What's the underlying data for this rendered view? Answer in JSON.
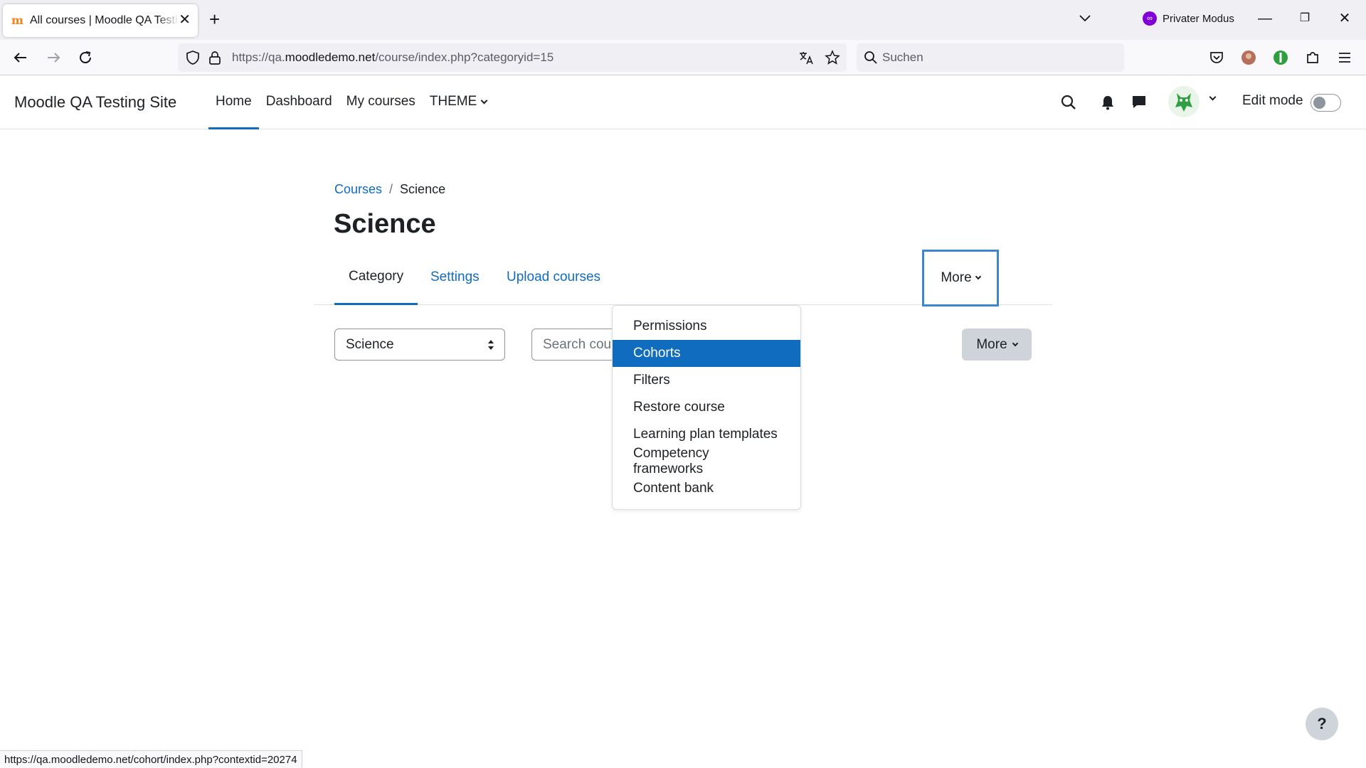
{
  "browser": {
    "tab_title": "All courses | Moodle QA Testing Site",
    "private_mode_label": "Privater Modus",
    "url_prefix": "https://qa.",
    "url_host": "moodledemo.net",
    "url_path": "/course/index.php?categoryid=15",
    "search_placeholder": "Suchen",
    "status_url": "https://qa.moodledemo.net/cohort/index.php?contextid=20274"
  },
  "header": {
    "site_name": "Moodle QA Testing Site",
    "nav": [
      "Home",
      "Dashboard",
      "My courses",
      "THEME"
    ],
    "edit_mode_label": "Edit mode"
  },
  "breadcrumb": {
    "courses": "Courses",
    "separator": "/",
    "current": "Science"
  },
  "page": {
    "title": "Science",
    "tabs": {
      "category": "Category",
      "settings": "Settings",
      "upload": "Upload courses",
      "more": "More"
    },
    "category_select_value": "Science",
    "search_placeholder": "Search cour",
    "more_button": "More"
  },
  "dropdown": {
    "items": [
      "Permissions",
      "Cohorts",
      "Filters",
      "Restore course",
      "Learning plan templates",
      "Competency frameworks",
      "Content bank"
    ],
    "highlighted": "Cohorts"
  },
  "help_label": "?",
  "colors": {
    "accent": "#0f6cbf",
    "private": "#8000d7"
  }
}
